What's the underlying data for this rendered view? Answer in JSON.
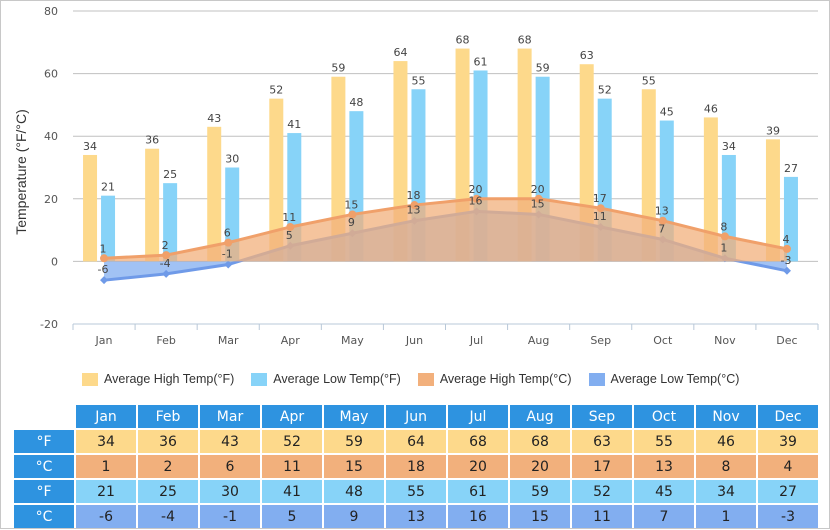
{
  "chart_data": {
    "type": "bar",
    "title": "",
    "xlabel": "",
    "ylabel": "Temperature (°F/°C)",
    "ylim": [
      -20,
      80
    ],
    "yticks": [
      -20,
      0,
      20,
      40,
      60,
      80
    ],
    "grid": true,
    "legend_position": "bottom",
    "categories": [
      "Jan",
      "Feb",
      "Mar",
      "Apr",
      "May",
      "Jun",
      "Jul",
      "Aug",
      "Sep",
      "Oct",
      "Nov",
      "Dec"
    ],
    "series": [
      {
        "name": "Average High Temp(°F)",
        "type": "bar",
        "color": "#fdd98b",
        "values": [
          34,
          36,
          43,
          52,
          59,
          64,
          68,
          68,
          63,
          55,
          46,
          39
        ]
      },
      {
        "name": "Average Low Temp(°F)",
        "type": "bar",
        "color": "#87d3f8",
        "values": [
          21,
          25,
          30,
          41,
          48,
          55,
          61,
          59,
          52,
          45,
          34,
          27
        ]
      },
      {
        "name": "Average High Temp(°C)",
        "type": "area",
        "color": "#f2b07c",
        "values": [
          1,
          2,
          6,
          11,
          15,
          18,
          20,
          20,
          17,
          13,
          8,
          4
        ]
      },
      {
        "name": "Average Low Temp(°C)",
        "type": "area",
        "color": "#82aef0",
        "values": [
          -6,
          -4,
          -1,
          5,
          9,
          13,
          16,
          15,
          11,
          7,
          1,
          -3
        ]
      }
    ]
  },
  "table": {
    "months": [
      "Jan",
      "Feb",
      "Mar",
      "Apr",
      "May",
      "Jun",
      "Jul",
      "Aug",
      "Sep",
      "Oct",
      "Nov",
      "Dec"
    ],
    "rows": [
      {
        "unit": "°F",
        "values": [
          "34",
          "36",
          "43",
          "52",
          "59",
          "64",
          "68",
          "68",
          "63",
          "55",
          "46",
          "39"
        ]
      },
      {
        "unit": "°C",
        "values": [
          "1",
          "2",
          "6",
          "11",
          "15",
          "18",
          "20",
          "20",
          "17",
          "13",
          "8",
          "4"
        ]
      },
      {
        "unit": "°F",
        "values": [
          "21",
          "25",
          "30",
          "41",
          "48",
          "55",
          "61",
          "59",
          "52",
          "45",
          "34",
          "27"
        ]
      },
      {
        "unit": "°C",
        "values": [
          "-6",
          "-4",
          "-1",
          "5",
          "9",
          "13",
          "16",
          "15",
          "11",
          "7",
          "1",
          "-3"
        ]
      }
    ]
  }
}
